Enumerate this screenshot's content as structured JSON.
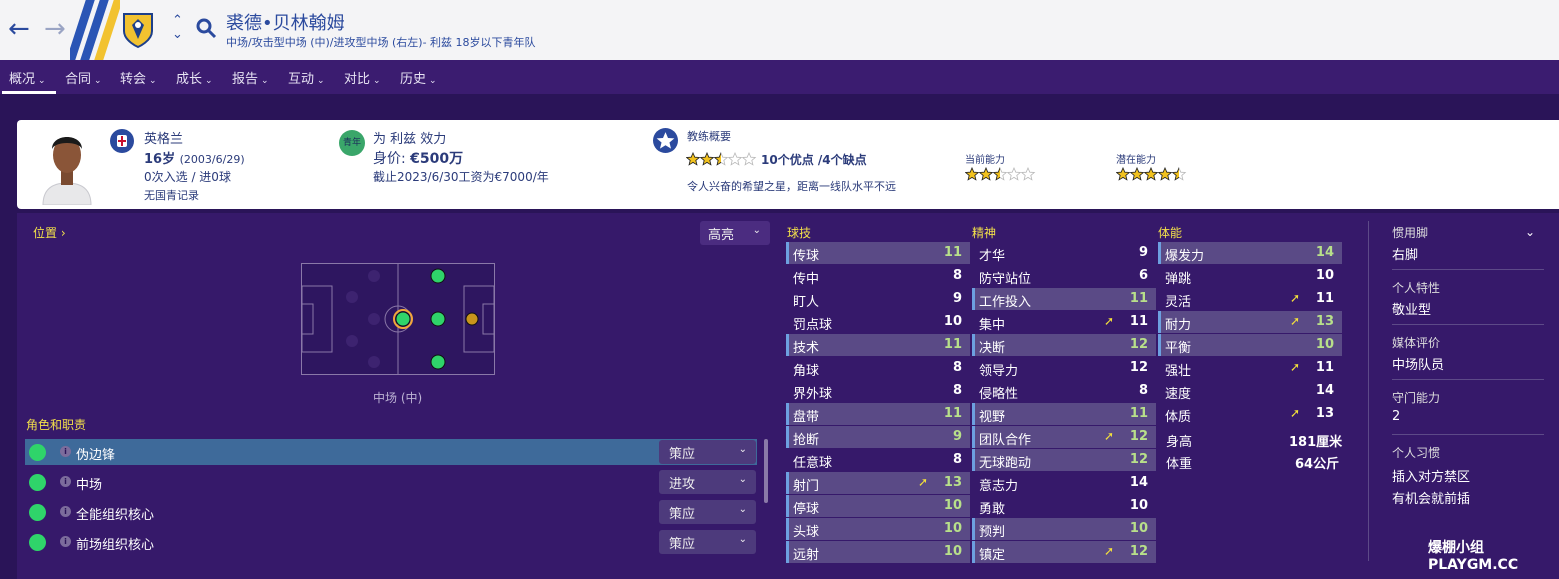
{
  "header": {
    "back_icon": "arrow-left-icon",
    "forward_icon": "arrow-right-icon",
    "player_name": "裘德•贝林翰姆",
    "subtitle": "中场/攻击型中场 (中)/进攻型中场 (右左)- 利兹 18岁以下青年队",
    "accent_color": "#2b4a9e"
  },
  "menu": [
    {
      "label": "概况"
    },
    {
      "label": "合同"
    },
    {
      "label": "转会"
    },
    {
      "label": "成长"
    },
    {
      "label": "报告"
    },
    {
      "label": "互动"
    },
    {
      "label": "对比"
    },
    {
      "label": "历史"
    }
  ],
  "card": {
    "nation": "英格兰",
    "age": "16岁",
    "dob": "(2003/6/29)",
    "caps": "0次入选 / 进0球",
    "youth_caps": "无国青记录",
    "club_badge": "青年",
    "plays_for": "为 利兹 效力",
    "value_label": "身价: ",
    "value": "€500万",
    "contract": "截止2023/6/30工资为€7000/年",
    "coach_title": "教练概要",
    "coach_summary": "10个优点 /4个缺点",
    "coach_stars": 2.5,
    "coach_text": "令人兴奋的希望之星，距离一线队水平不远",
    "ca_label": "当前能力",
    "ca_stars": 2.5,
    "pa_label": "潜在能力",
    "pa_stars": 4.5
  },
  "position": {
    "title": "位置",
    "highlight": "高亮",
    "pitch_label": "中场 (中)"
  },
  "roles": {
    "title": "角色和职责",
    "items": [
      {
        "name": "伪边锋",
        "duty": "策应"
      },
      {
        "name": "中场",
        "duty": "进攻"
      },
      {
        "name": "全能组织核心",
        "duty": "策应"
      },
      {
        "name": "前场组织核心",
        "duty": "策应"
      }
    ]
  },
  "attributes": {
    "technical_title": "球技",
    "mental_title": "精神",
    "physical_title": "体能",
    "technical": [
      {
        "name": "传球",
        "value": "11"
      },
      {
        "name": "传中",
        "value": "8"
      },
      {
        "name": "盯人",
        "value": "9"
      },
      {
        "name": "罚点球",
        "value": "10"
      },
      {
        "name": "技术",
        "value": "11"
      },
      {
        "name": "角球",
        "value": "8"
      },
      {
        "name": "界外球",
        "value": "8"
      },
      {
        "name": "盘带",
        "value": "11"
      },
      {
        "name": "抢断",
        "value": "9"
      },
      {
        "name": "任意球",
        "value": "8"
      },
      {
        "name": "射门",
        "value": "13"
      },
      {
        "name": "停球",
        "value": "10"
      },
      {
        "name": "头球",
        "value": "10"
      },
      {
        "name": "远射",
        "value": "10"
      }
    ],
    "mental": [
      {
        "name": "才华",
        "value": "9"
      },
      {
        "name": "防守站位",
        "value": "6"
      },
      {
        "name": "工作投入",
        "value": "11"
      },
      {
        "name": "集中",
        "value": "11"
      },
      {
        "name": "决断",
        "value": "12"
      },
      {
        "name": "领导力",
        "value": "12"
      },
      {
        "name": "侵略性",
        "value": "8"
      },
      {
        "name": "视野",
        "value": "11"
      },
      {
        "name": "团队合作",
        "value": "12"
      },
      {
        "name": "无球跑动",
        "value": "12"
      },
      {
        "name": "意志力",
        "value": "14"
      },
      {
        "name": "勇敢",
        "value": "10"
      },
      {
        "name": "预判",
        "value": "10"
      },
      {
        "name": "镇定",
        "value": "12"
      }
    ],
    "physical": [
      {
        "name": "爆发力",
        "value": "14"
      },
      {
        "name": "弹跳",
        "value": "10"
      },
      {
        "name": "灵活",
        "value": "11"
      },
      {
        "name": "耐力",
        "value": "13"
      },
      {
        "name": "平衡",
        "value": "10"
      },
      {
        "name": "强壮",
        "value": "11"
      },
      {
        "name": "速度",
        "value": "14"
      },
      {
        "name": "体质",
        "value": "13"
      }
    ],
    "height_label": "身高",
    "height": "181厘米",
    "weight_label": "体重",
    "weight": "64公斤"
  },
  "side": {
    "foot_label": "惯用脚",
    "foot": "右脚",
    "personality_label": "个人特性",
    "personality": "敬业型",
    "media_label": "媒体评价",
    "media": "中场队员",
    "gk_label": "守门能力",
    "gk": "2",
    "habits_label": "个人习惯",
    "habit1": "插入对方禁区",
    "habit2": "有机会就前插"
  },
  "watermark": "爆棚小组 PLAYGM.CC"
}
